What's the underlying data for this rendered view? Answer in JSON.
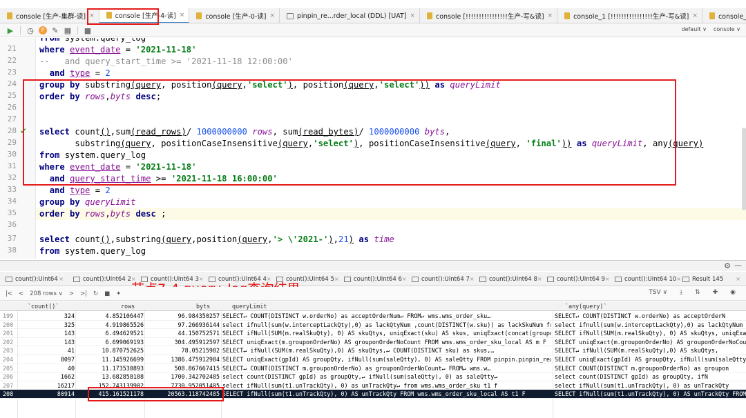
{
  "tabs": [
    {
      "label": "console [生产-集群-读]",
      "type": "console",
      "active": false
    },
    {
      "label": "console [生产-4-读]",
      "type": "console",
      "active": true
    },
    {
      "label": "console [生产-0-读]",
      "type": "console",
      "active": false
    },
    {
      "label": "pinpin_re...rder_local (DDL) [UAT]",
      "type": "table",
      "active": false
    },
    {
      "label": "console [!!!!!!!!!!!!!!!!生产-写&读]",
      "type": "console",
      "active": false
    },
    {
      "label": "console_1 [!!!!!!!!!!!!!!!!生产-写&读]",
      "type": "console",
      "active": false
    },
    {
      "label": "console_2 [!!!!!!!!!!!!!!!!生产-写&读]",
      "type": "console",
      "active": false
    },
    {
      "label": "co",
      "type": "console",
      "active": false
    }
  ],
  "toolbar": {
    "schema": "default ∨",
    "session": "console ∨"
  },
  "editor": {
    "line_numbers": [
      "21",
      "22",
      "23",
      "24",
      "25",
      "26",
      "27",
      "28",
      "29",
      "30",
      "31",
      "32",
      "33",
      "34",
      "35",
      "36",
      "37",
      "38"
    ],
    "top_fragment": "from system.query_log"
  },
  "results": {
    "tabs": [
      "count():UInt64",
      "count():UInt64 2",
      "count():UInt64 3",
      "count():UInt64 4",
      "count():UInt64 5",
      "count():UInt64 6",
      "count():UInt64 7",
      "count():UInt64 8",
      "count():UInt64 9",
      "count():UInt64 10",
      "Result 145"
    ],
    "row_count": "208 rows ∨",
    "format": "TSV ∨",
    "annotation": "节点7-4 query_log查询结果",
    "headers": [
      "`count()`",
      "rows",
      "byts",
      "queryLimit",
      "`any(query)`"
    ],
    "rows": [
      {
        "n": "199",
        "c": "324",
        "rows": "4.852106447",
        "byts": "96.984350257",
        "ql": "SELECT↵        COUNT(DISTINCT w.orderNo) as acceptOrderNum↵          FROM↵        wms.wms_order_sku…",
        "aq": "SELECT↵        COUNT(DISTINCT w.orderNo) as acceptOrderN"
      },
      {
        "n": "200",
        "c": "325",
        "rows": "4.919865526",
        "byts": "97.266936144",
        "ql": "select ifnull(sum(w.interceptLackQty),0) as lackQtyNum ,count(DISTINCT(w.sku)) as lackSkuNum from…",
        "aq": "select ifnull(sum(w.interceptLackQty),0) as lackQtyNum ,c"
      },
      {
        "n": "201",
        "c": "143",
        "rows": "6.494629521",
        "byts": "44.150752571",
        "ql": "SELECT ifNull(SUM(m.realSkuQty), 0) AS skuQtys, uniqExact(sku) AS skus, uniqExact(concat(groupon…",
        "aq": "SELECT ifNull(SUM(m.realSkuQty), 0) AS skuQtys, uniqExact"
      },
      {
        "n": "202",
        "c": "143",
        "rows": "6.699069193",
        "byts": "304.495912597",
        "ql": "SELECT uniqExact(m.grouponOrderNo) AS grouponOrderNoCount FROM wms.wms_order_sku_local AS m F",
        "aq": "SELECT uniqExact(m.grouponOrderNo) AS grouponOrderNoCount"
      },
      {
        "n": "203",
        "c": "41",
        "rows": "10.870752625",
        "byts": "78.05215982",
        "ql": "SELECT↵              ifNull(SUM(m.realSkuQty),0) AS skuQtys,↵           COUNT(DISTINCT sku) as skus,…",
        "aq": "SELECT↵        ifNull(SUM(m.realSkuQty),0) AS skuQtys,"
      },
      {
        "n": "204",
        "c": "8097",
        "rows": "11.145926699",
        "byts": "1386.475912984",
        "ql": "SELECT uniqExact(gpId) AS groupQty, ifNull(sum(saleQtty), 0) AS saleQtty FROM pinpin.pinpin_real…",
        "aq": "SELECT uniqExact(gpId) AS groupQty, ifNull(sum(saleQtty)"
      },
      {
        "n": "205",
        "c": "40",
        "rows": "11.173530893",
        "byts": "508.867667415",
        "ql": "SELECT↵       COUNT(DISTINCT m.grouponOrderNo) as grouponOrderNoCount↵          FROM↵        wms.w…",
        "aq": "SELECT COUNT(DISTINCT m.grouponOrderNo) as groupon"
      },
      {
        "n": "206",
        "c": "1662",
        "rows": "13.682858188",
        "byts": "1700.342702485",
        "ql": "select count(DISTINCT gpId)        as groupQty,↵        ifNull(sum(saleQtty), 0) as saleQtty↵",
        "aq": "select count(DISTINCT gpId)        as groupQty,        ifN"
      },
      {
        "n": "207",
        "c": "16217",
        "rows": "152.743139902",
        "byts": "7730.952051405",
        "ql": "select ifNull(sum(t1.unTrackQty), 0) as unTrackQty↵           from wms.wms_order_sku t1 f",
        "aq": "select ifNull(sum(t1.unTrackQty), 0) as unTrackQty"
      },
      {
        "n": "208",
        "c": "80914",
        "rows": "415.161521178",
        "byts": "20563.118742485",
        "ql": "SELECT ifNull(sum(t1.unTrackQty), 0) AS unTrackQty FROM wms.wms_order_sku_local AS t1 F",
        "aq": "SELECT ifNull(sum(t1.unTrackQty), 0) AS unTrackQty FROM "
      }
    ]
  },
  "colors": {
    "highlight_box": "#e41a1a",
    "keyword": "#000080",
    "string": "#067d17",
    "alias": "#871094",
    "number": "#1750eb"
  }
}
